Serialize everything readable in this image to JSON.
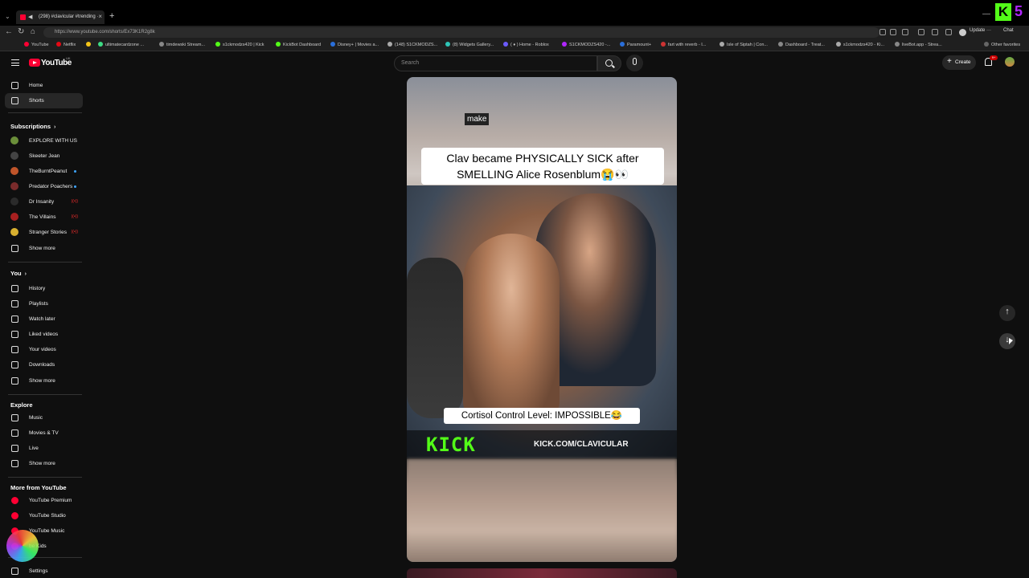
{
  "browser": {
    "tab_title": "(298) #clavicular #trending ·",
    "url": "https://www.youtube.com/shorts/Ex73K1R2g8k",
    "update_label": "Update",
    "chat_label": "Chat",
    "bookmarks": [
      "YouTube",
      "Netflix",
      "",
      "ultimatecardzone ...",
      "timdewski Stream...",
      "s1ckmodzs420 | Kick",
      "KickBot Dashboard",
      "Disney+ | Movies a...",
      "(148) S1CKMODZS...",
      "(8) Widgets Gallery...",
      "( ♦ ) Home - Roblox",
      "S1CKMODZS420 -...",
      "Paramount+",
      "fart with reverb - I...",
      "Isle of Siptah | Con...",
      "Dashboard - Treat...",
      "s1ckmodzs420 - Ki...",
      "liveBot.app - Strea...",
      "Other favorites"
    ]
  },
  "header": {
    "logo_text": "YouTube",
    "region": "UK",
    "search_placeholder": "Search",
    "create_label": "Create",
    "notification_count": "9+"
  },
  "sidebar": {
    "top": [
      {
        "label": "Home",
        "icon": "home-icon"
      },
      {
        "label": "Shorts",
        "icon": "shorts-icon",
        "active": true
      }
    ],
    "subscriptions_heading": "Subscriptions",
    "subscriptions": [
      {
        "label": "EXPLORE WITH US",
        "color": "#6b8f3a"
      },
      {
        "label": "Skeeter Jean",
        "color": "#444444"
      },
      {
        "label": "TheBurntPeanut",
        "color": "#c0552a",
        "dot": true
      },
      {
        "label": "Predator Poachers",
        "color": "#7a2b2b",
        "dot": true
      },
      {
        "label": "Dr Insanity",
        "color": "#2b2b2b",
        "live": true
      },
      {
        "label": "The Villains",
        "color": "#a82020",
        "live": true
      },
      {
        "label": "Stranger Stories",
        "color": "#d8b030",
        "live": true
      }
    ],
    "subs_show_more": "Show more",
    "you_heading": "You",
    "you_items": [
      {
        "label": "History",
        "icon": "history-icon"
      },
      {
        "label": "Playlists",
        "icon": "playlists-icon"
      },
      {
        "label": "Watch later",
        "icon": "clock-icon"
      },
      {
        "label": "Liked videos",
        "icon": "thumbs-up-icon"
      },
      {
        "label": "Your videos",
        "icon": "play-square-icon"
      },
      {
        "label": "Downloads",
        "icon": "download-icon"
      }
    ],
    "you_show_more": "Show more",
    "explore_heading": "Explore",
    "explore_items": [
      {
        "label": "Music",
        "icon": "music-note-icon"
      },
      {
        "label": "Movies & TV",
        "icon": "film-icon"
      },
      {
        "label": "Live",
        "icon": "live-icon"
      }
    ],
    "explore_show_more": "Show more",
    "more_heading": "More from YouTube",
    "more_items": [
      {
        "label": "YouTube Premium"
      },
      {
        "label": "YouTube Studio"
      },
      {
        "label": "YouTube Music"
      },
      {
        "label": "be Kids"
      }
    ],
    "settings_label": "Settings"
  },
  "short": {
    "caption_word": "make",
    "title_line1": "Clav became PHYSICALLY SICK after",
    "title_line2": "SMELLING Alice Rosenblum😭👀",
    "overlay_text": "Cortisol Control Level: IMPOSSIBLE😂",
    "kick_logo": "KICK",
    "kick_url": "KICK.COM/CLAVICULAR"
  },
  "colors": {
    "accent_red": "#ff0033",
    "kick_green": "#53fc18",
    "background": "#0f0f0f"
  }
}
